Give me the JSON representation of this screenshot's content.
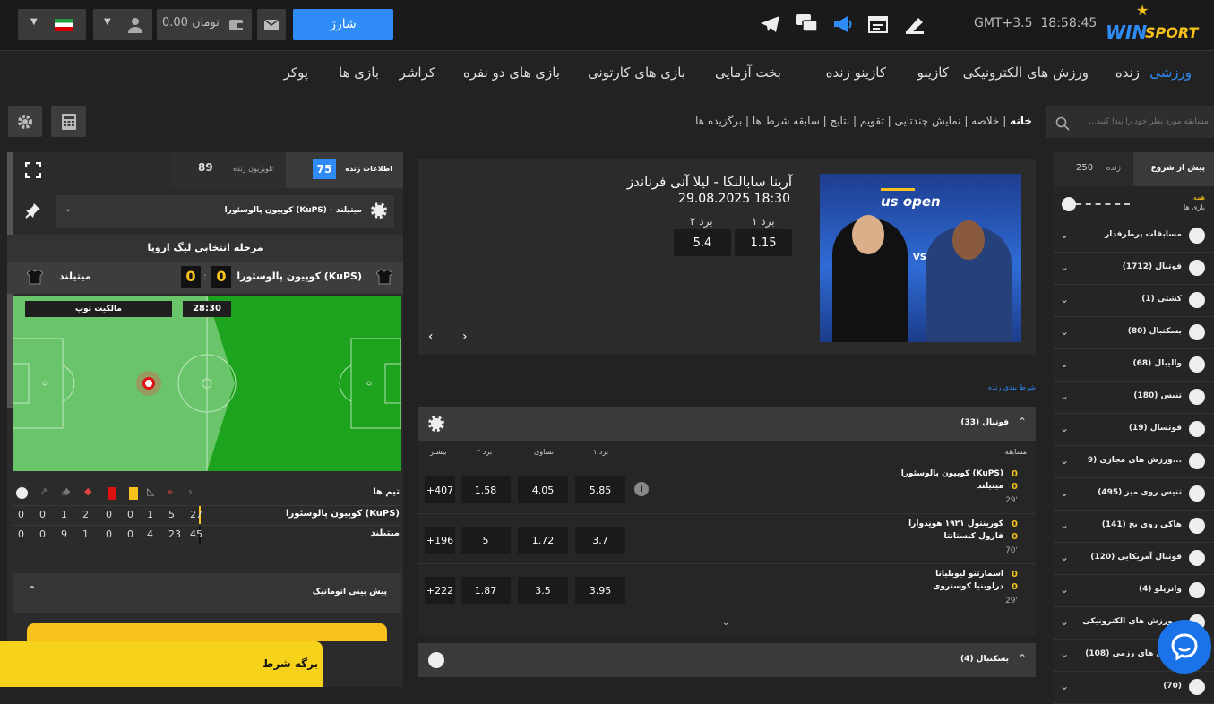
{
  "topbar": {
    "clock": "GMT+3.5  18:58:45",
    "brand_win": "WIN",
    "brand_sport": "SPORT",
    "charge_button": "شارژ",
    "balance": "0.00 تومان"
  },
  "nav": {
    "items": [
      "ورزشی",
      "زنده",
      "ورزش های الکترونیکی",
      "کازینو",
      "کازینو زنده",
      "بخت آزمایی",
      "بازی های کارتونی",
      "بازی های دو نفره",
      "کراشر",
      "بازی ها",
      "پوکر"
    ]
  },
  "search": {
    "placeholder": "مسابقه مورد نظر خود را پیدا کنید..."
  },
  "breadcrumb": [
    "خانه",
    "خلاصه",
    "نمایش چندتایی",
    "تقویم",
    "نتایج",
    "سابقه شرط ها",
    "برگزیده ها"
  ],
  "sports_panel": {
    "tab_prematch": "پیش از شروع",
    "tab_live": "زنده",
    "live_count": "250",
    "all_label": "همه",
    "games_label": "بازی ها",
    "items": [
      {
        "label": "مسابقات پرطرفدار",
        "icon": "trophy-icon"
      },
      {
        "label": "فوتبال (1712)",
        "icon": "football-icon"
      },
      {
        "label": "کشتی (1)",
        "icon": "wrestling-icon"
      },
      {
        "label": "بسکتبال (80)",
        "icon": "basketball-icon"
      },
      {
        "label": "والیبال (68)",
        "icon": "volleyball-icon"
      },
      {
        "label": "تنیس (180)",
        "icon": "tennis-icon"
      },
      {
        "label": "فوتسال (19)",
        "icon": "futsal-icon"
      },
      {
        "label": "ورزش های مجازی (9...",
        "icon": "virtual-sports-icon"
      },
      {
        "label": "تنیس روی میز (495)",
        "icon": "table-tennis-icon"
      },
      {
        "label": "هاکی روی یخ (141)",
        "icon": "ice-hockey-icon"
      },
      {
        "label": "فوتبال آمریکایی (120)",
        "icon": "american-football-icon"
      },
      {
        "label": "واترپلو (4)",
        "icon": "waterpolo-icon"
      },
      {
        "label": "ورزش های الکترونیکی...",
        "icon": "esports-icon"
      },
      {
        "label": "ورزش های رزمی (108)",
        "icon": "martial-arts-icon"
      },
      {
        "label": "(70)",
        "icon": "misc-sport-icon"
      }
    ]
  },
  "featured": {
    "title": "آرینا سابالنکا - لیلا آنی فرناندز",
    "datetime": "29.08.2025 18:30",
    "w1_label": "برد ۱",
    "w2_label": "برد ۲",
    "w1": "1.15",
    "w2": "5.4",
    "banner_text": "us open",
    "vs": "VS"
  },
  "live_link": "شرط بندی زنده",
  "football_section": {
    "title": "فوتبال (33)",
    "headers": {
      "match": "مسابقه",
      "w1": "برد ۱",
      "draw": "تساوی",
      "w2": "برد ۲",
      "more": "بیشتر"
    },
    "rows": [
      {
        "team1": "کوپیون پالوسئورا (KuPS)",
        "team2": "میتیلند",
        "s1": "0",
        "s2": "0",
        "time": "29'",
        "w1": "5.85",
        "x": "4.05",
        "w2": "1.58",
        "more": "+407"
      },
      {
        "team1": "کورینتول ۱۹۲۱ هونِدوارا",
        "team2": "فارول کنستانتا",
        "s1": "0",
        "s2": "0",
        "time": "70'",
        "w1": "3.7",
        "x": "1.72",
        "w2": "5",
        "more": "+196"
      },
      {
        "team1": "اسمارتنو لیوبلیانا",
        "team2": "درلوینیا کوستروی",
        "s1": "0",
        "s2": "0",
        "time": "29'",
        "w1": "3.95",
        "x": "3.5",
        "w2": "1.87",
        "more": "+222"
      }
    ]
  },
  "basketball_section": {
    "title": "بسکتبال (4)"
  },
  "live_panel": {
    "tab_info": "اطلاعات زنده",
    "info_count": "75",
    "tab_tv": "تلویزیون زنده",
    "tv_count": "89",
    "match_select": "کوپیون پالوسئورا (KuPS) - میتیلند",
    "stage": "مرحله انتخابی لیگ اروپا",
    "home": "کوپیون پالوسئورا (KuPS)",
    "away": "میتیلند",
    "home_score": "0",
    "away_score": "0",
    "clock": "28:30",
    "possession": "مالکیت توپ",
    "teams_label": "تیم ها",
    "stat_rows": [
      {
        "team": "کوپیون پالوسئورا (KuPS)",
        "vals": [
          "27",
          "5",
          "1",
          "0",
          "0",
          "2",
          "1",
          "0",
          "0"
        ]
      },
      {
        "team": "میتیلند",
        "vals": [
          "45",
          "23",
          "4",
          "0",
          "0",
          "1",
          "9",
          "0",
          "0"
        ]
      }
    ],
    "auto_predict": "پیش بینی اتوماتیک"
  },
  "betslip": {
    "label": "برگه شرط"
  },
  "colors": {
    "accent": "#2f8cf7",
    "gold": "#f6c21b",
    "bg": "#222222",
    "field": "#1ea31e"
  }
}
